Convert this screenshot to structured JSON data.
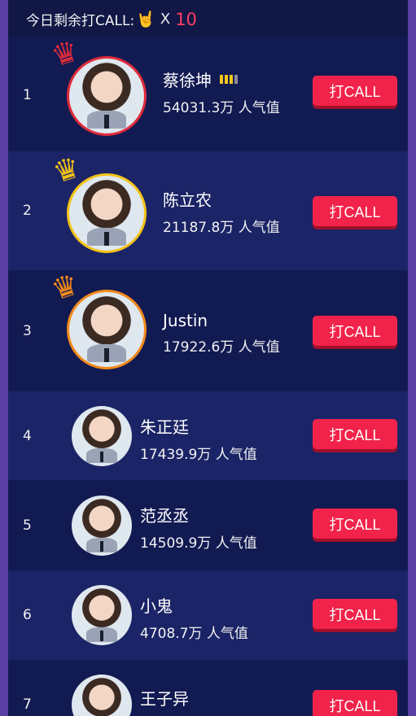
{
  "header": {
    "label": "今日剩余打CALL:",
    "hand_icon": "rock-hand-icon",
    "times": "X",
    "count": "10"
  },
  "call_button_label": "打CALL",
  "rows": [
    {
      "rank": "1",
      "name": "蔡徐坤",
      "popularity": "54031.3万 人气值",
      "crown": "red"
    },
    {
      "rank": "2",
      "name": "陈立农",
      "popularity": "21187.8万 人气值",
      "crown": "gold"
    },
    {
      "rank": "3",
      "name": "Justin",
      "popularity": "17922.6万 人气值",
      "crown": "orange"
    },
    {
      "rank": "4",
      "name": "朱正廷",
      "popularity": "17439.9万 人气值",
      "crown": ""
    },
    {
      "rank": "5",
      "name": "范丞丞",
      "popularity": "14509.9万 人气值",
      "crown": ""
    },
    {
      "rank": "6",
      "name": "小鬼",
      "popularity": "4708.7万 人气值",
      "crown": ""
    },
    {
      "rank": "7",
      "name": "王子异",
      "popularity": "",
      "crown": ""
    }
  ],
  "colors": {
    "background": "#121a52",
    "row_alt": "#1b2466",
    "button": "#f2234a",
    "accent_count": "#ff3d64",
    "crown_red": "#e02b3a",
    "crown_gold": "#f3c316",
    "crown_orange": "#f28a1a"
  }
}
